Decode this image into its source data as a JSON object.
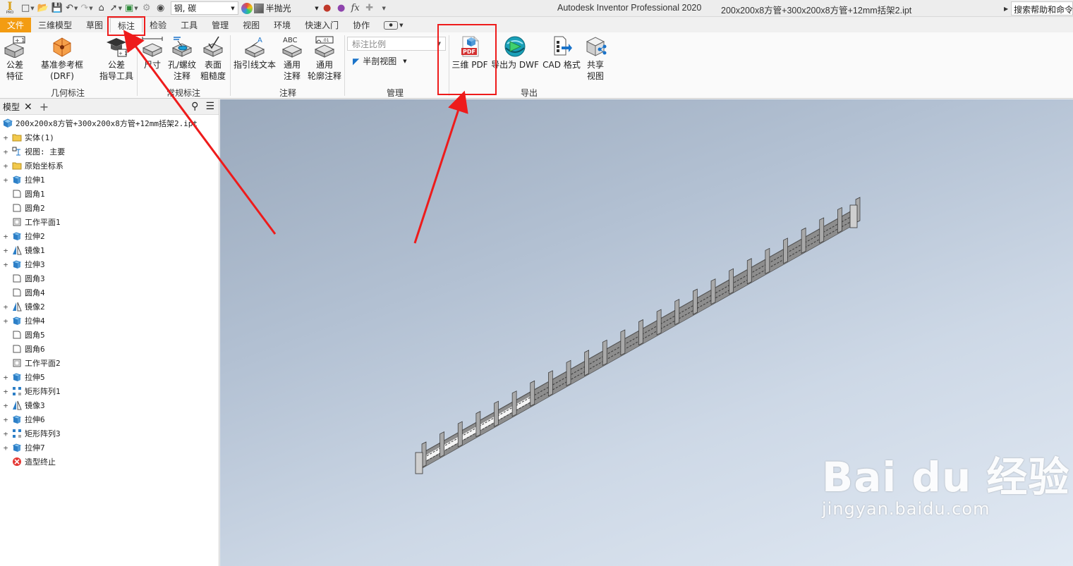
{
  "app": {
    "title": "Autodesk Inventor Professional 2020",
    "document": "200x200x8方管+300x200x8方管+12mm括架2.ipt",
    "help_search": "搜索帮助和命令"
  },
  "qat": {
    "material": "钢, 碳",
    "appearance": "半抛光"
  },
  "tabs": [
    "文件",
    "三维模型",
    "草图",
    "标注",
    "检验",
    "工具",
    "管理",
    "视图",
    "环境",
    "快速入门",
    "协作"
  ],
  "active_tab": "标注",
  "ribbon": {
    "geometric": {
      "label": "几何标注",
      "tolerance_feature": "公差\n特征",
      "drf": "基准参考框(DRF)",
      "tolerance_advisor": "公差\n指导工具"
    },
    "general": {
      "label": "常规标注",
      "dimension": "尺寸",
      "hole_thread": "孔/螺纹\n注释",
      "surface_texture": "表面\n粗糙度"
    },
    "notes": {
      "label": "注释",
      "leader_text": "指引线文本",
      "general_note": "通用\n注释",
      "general_profile_note": "通用\n轮廓注释"
    },
    "manage": {
      "label": "管理",
      "annotation_scale_placeholder": "标注比例",
      "half_section": "半剖视图"
    },
    "export": {
      "label": "导出",
      "pdf_3d": "三维 PDF",
      "export_dwf": "导出为 DWF",
      "cad_format": "CAD 格式",
      "share_view": "共享\n视图"
    }
  },
  "browser": {
    "tab": "模型",
    "root": "200x200x8方管+300x200x8方管+12mm括架2.ipt",
    "items": [
      {
        "label": "实体(1)",
        "icon": "folder-icon",
        "expand": true
      },
      {
        "label": "视图: 主要",
        "icon": "view-icon",
        "expand": true
      },
      {
        "label": "原始坐标系",
        "icon": "folder-icon",
        "expand": true
      },
      {
        "label": "拉伸1",
        "icon": "extrude-icon",
        "expand": true
      },
      {
        "label": "圆角1",
        "icon": "fillet-icon",
        "expand": false
      },
      {
        "label": "圆角2",
        "icon": "fillet-icon",
        "expand": false
      },
      {
        "label": "工作平面1",
        "icon": "work-plane-icon",
        "expand": false
      },
      {
        "label": "拉伸2",
        "icon": "extrude-icon",
        "expand": true
      },
      {
        "label": "镜像1",
        "icon": "mirror-icon",
        "expand": true
      },
      {
        "label": "拉伸3",
        "icon": "extrude-icon",
        "expand": true
      },
      {
        "label": "圆角3",
        "icon": "fillet-icon",
        "expand": false
      },
      {
        "label": "圆角4",
        "icon": "fillet-icon",
        "expand": false
      },
      {
        "label": "镜像2",
        "icon": "mirror-icon",
        "expand": true
      },
      {
        "label": "拉伸4",
        "icon": "extrude-icon",
        "expand": true
      },
      {
        "label": "圆角5",
        "icon": "fillet-icon",
        "expand": false
      },
      {
        "label": "圆角6",
        "icon": "fillet-icon",
        "expand": false
      },
      {
        "label": "工作平面2",
        "icon": "work-plane-icon",
        "expand": false
      },
      {
        "label": "拉伸5",
        "icon": "extrude-icon",
        "expand": true
      },
      {
        "label": "矩形阵列1",
        "icon": "rect-pattern-icon",
        "expand": true
      },
      {
        "label": "镜像3",
        "icon": "mirror-icon",
        "expand": true
      },
      {
        "label": "拉伸6",
        "icon": "extrude-icon",
        "expand": true
      },
      {
        "label": "矩形阵列3",
        "icon": "rect-pattern-icon",
        "expand": true
      },
      {
        "label": "拉伸7",
        "icon": "extrude-icon",
        "expand": true
      },
      {
        "label": "造型终止",
        "icon": "end-of-part-icon",
        "expand": false
      }
    ]
  },
  "watermark": {
    "brand": "Bai du 经验",
    "url": "jingyan.baidu.com"
  },
  "colors": {
    "file_tab": "#f39c12",
    "annotation": "#ee1b1b",
    "pdf_red": "#d32f2f"
  }
}
